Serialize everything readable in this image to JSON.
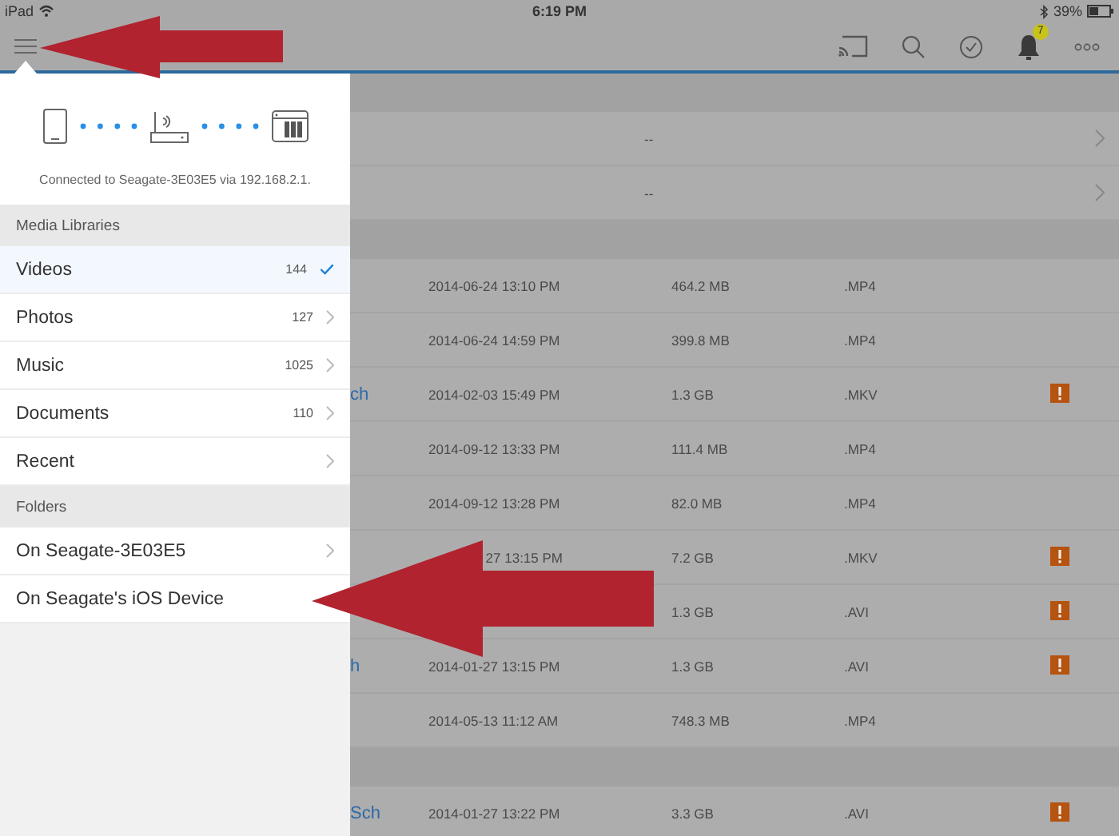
{
  "status_bar": {
    "carrier": "iPad",
    "time": "6:19 PM",
    "battery": "39%"
  },
  "toolbar": {
    "notification_count": "7"
  },
  "connection": {
    "caption": "Connected to Seagate-3E03E5 via 192.168.2.1."
  },
  "sidebar": {
    "sections": [
      {
        "title": "Media Libraries",
        "items": [
          {
            "label": "Videos",
            "count": "144",
            "selected": true
          },
          {
            "label": "Photos",
            "count": "127",
            "selected": false
          },
          {
            "label": "Music",
            "count": "1025",
            "selected": false
          },
          {
            "label": "Documents",
            "count": "110",
            "selected": false
          },
          {
            "label": "Recent",
            "selected": false
          }
        ]
      },
      {
        "title": "Folders",
        "items": [
          {
            "label": "On Seagate-3E03E5",
            "selected": false
          },
          {
            "label": "On Seagate's iOS Device",
            "selected": false
          }
        ]
      }
    ]
  },
  "list": {
    "groups": [
      {
        "rows": [
          {
            "kind": "summary",
            "value": "--"
          },
          {
            "kind": "summary",
            "value": "--"
          }
        ]
      },
      {
        "rows": [
          {
            "kind": "file",
            "date": "2014-06-24 13:10 PM",
            "size": "464.2 MB",
            "type": ".MP4",
            "warning": false
          },
          {
            "kind": "file",
            "date": "2014-06-24 14:59 PM",
            "size": "399.8 MB",
            "type": ".MP4",
            "warning": false
          },
          {
            "kind": "file",
            "name": "ch",
            "date": "2014-02-03 15:49 PM",
            "size": "1.3 GB",
            "type": ".MKV",
            "warning": true
          },
          {
            "kind": "file",
            "date": "2014-09-12 13:33 PM",
            "size": "111.4 MB",
            "type": ".MP4",
            "warning": false
          },
          {
            "kind": "file",
            "date": "2014-09-12 13:28 PM",
            "size": "82.0 MB",
            "type": ".MP4",
            "warning": false
          },
          {
            "kind": "file",
            "date": "27 13:15 PM",
            "date_cut": true,
            "size": "7.2 GB",
            "type": ".MKV",
            "warning": true
          },
          {
            "kind": "file",
            "size": "1.3 GB",
            "type": ".AVI",
            "warning": true
          },
          {
            "kind": "file",
            "name": "h",
            "date": "2014-01-27 13:15 PM",
            "size": "1.3 GB",
            "type": ".AVI",
            "warning": true
          },
          {
            "kind": "file",
            "date": "2014-05-13 11:12 AM",
            "size": "748.3 MB",
            "type": ".MP4",
            "warning": false
          }
        ]
      },
      {
        "rows": [
          {
            "kind": "file",
            "name": "Sch",
            "date": "2014-01-27 13:22 PM",
            "size": "3.3 GB",
            "type": ".AVI",
            "warning": true
          }
        ]
      }
    ]
  }
}
